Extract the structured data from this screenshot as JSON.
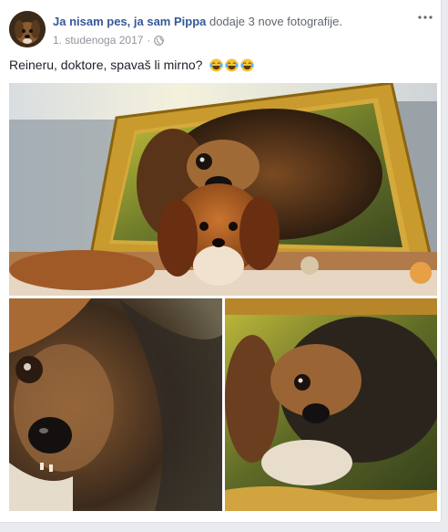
{
  "post": {
    "author": "Ja nisam pes, ja sam Pippa",
    "action": " dodaje 3 nove fotografije.",
    "date": "1. studenoga 2017",
    "separator": "·",
    "privacy_icon": "globe-icon",
    "text": "Reineru, doktore, spavaš li mirno?",
    "emojis": [
      "laughing-tears-emoji",
      "laughing-tears-emoji",
      "laughing-tears-emoji"
    ]
  },
  "photos": [
    {
      "name": "photo-dog-with-portrait"
    },
    {
      "name": "photo-portrait-closeup"
    },
    {
      "name": "photo-portrait-framed"
    }
  ],
  "colors": {
    "link": "#365899",
    "meta": "#90949c",
    "text": "#1d2129",
    "gold": "#c99a2e"
  }
}
